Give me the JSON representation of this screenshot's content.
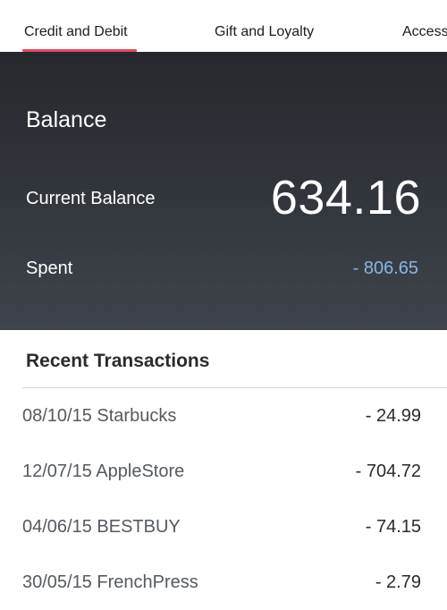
{
  "tabs": [
    {
      "label": "Credit and Debit",
      "active": true
    },
    {
      "label": "Gift and Loyalty",
      "active": false
    },
    {
      "label": "Access",
      "active": false
    }
  ],
  "colors": {
    "accent": "#e8475b",
    "card_top": "#26282d",
    "card_bottom": "#3f444c",
    "spent_value": "#8ab4e3"
  },
  "balance": {
    "title": "Balance",
    "current_label": "Current Balance",
    "current_value": "634.16",
    "spent_label": "Spent",
    "spent_value": "- 806.65"
  },
  "recent": {
    "title": "Recent Transactions",
    "transactions": [
      {
        "description": "08/10/15 Starbucks",
        "amount": "- 24.99"
      },
      {
        "description": "12/07/15 AppleStore",
        "amount": "- 704.72"
      },
      {
        "description": "04/06/15 BESTBUY",
        "amount": "- 74.15"
      },
      {
        "description": "30/05/15 FrenchPress",
        "amount": "- 2.79"
      }
    ]
  }
}
